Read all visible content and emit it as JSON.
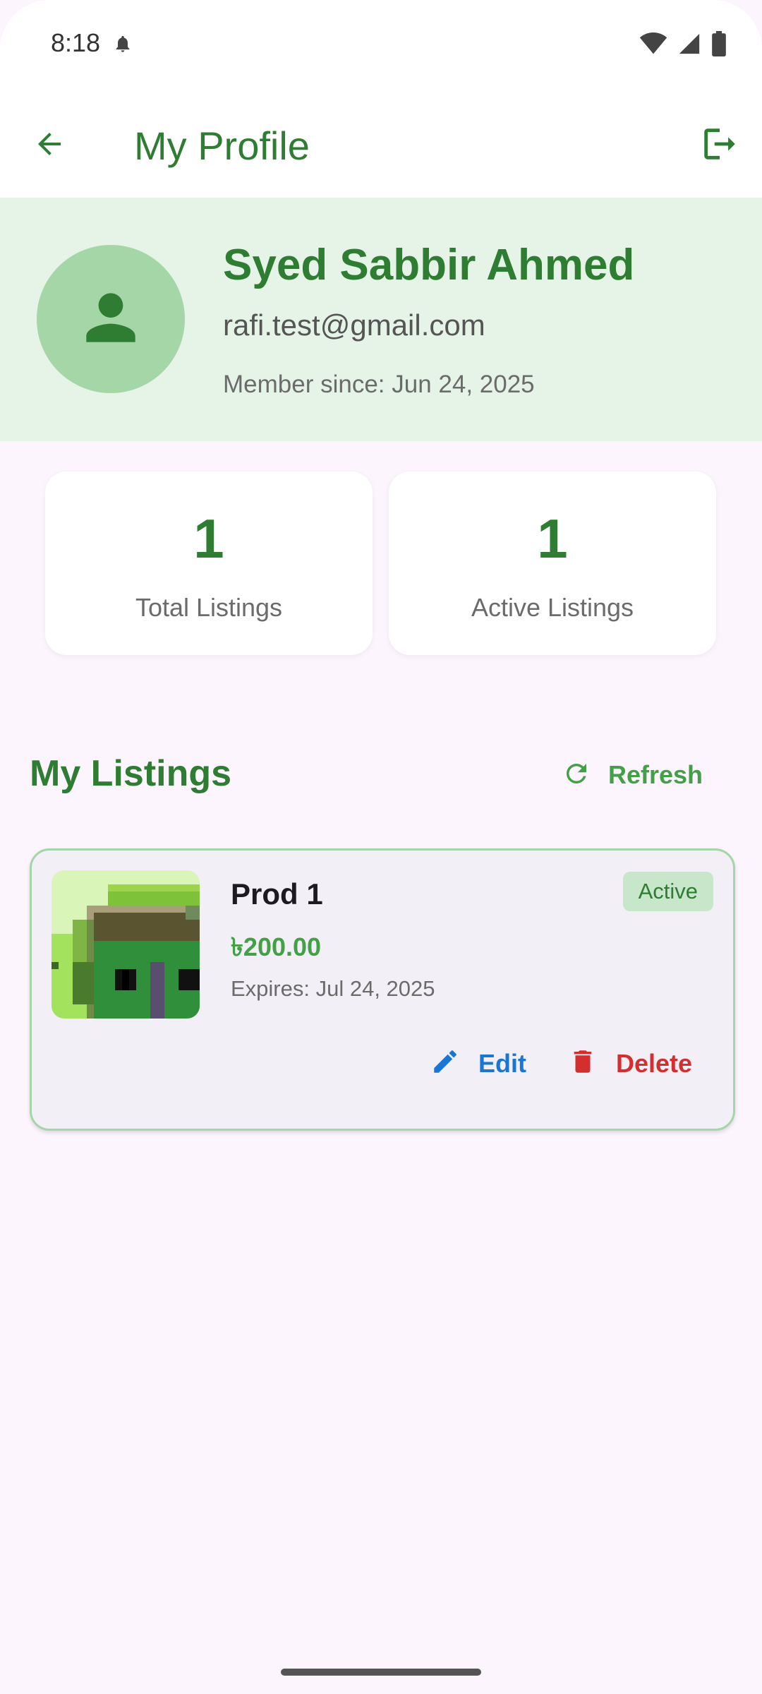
{
  "status_bar": {
    "time": "8:18"
  },
  "app_bar": {
    "title": "My Profile"
  },
  "profile": {
    "name": "Syed Sabbir Ahmed",
    "email": "rafi.test@gmail.com",
    "member_since": "Member since: Jun 24, 2025"
  },
  "stats": [
    {
      "value": "1",
      "label": "Total Listings"
    },
    {
      "value": "1",
      "label": "Active Listings"
    }
  ],
  "listings_section": {
    "title": "My Listings",
    "refresh_label": "Refresh"
  },
  "listings": [
    {
      "name": "Prod 1",
      "price": "৳200.00",
      "expires": "Expires: Jul 24, 2025",
      "status": "Active",
      "edit_label": "Edit",
      "delete_label": "Delete"
    }
  ],
  "icons": {
    "back": "arrow-back-icon",
    "logout": "logout-icon",
    "avatar": "person-icon",
    "refresh": "refresh-icon",
    "edit": "pencil-icon",
    "delete": "trash-icon"
  },
  "colors": {
    "primary": "#2e7d32",
    "header_bg": "#e6f4e7",
    "edit": "#1976d2",
    "delete": "#d32f2f"
  }
}
